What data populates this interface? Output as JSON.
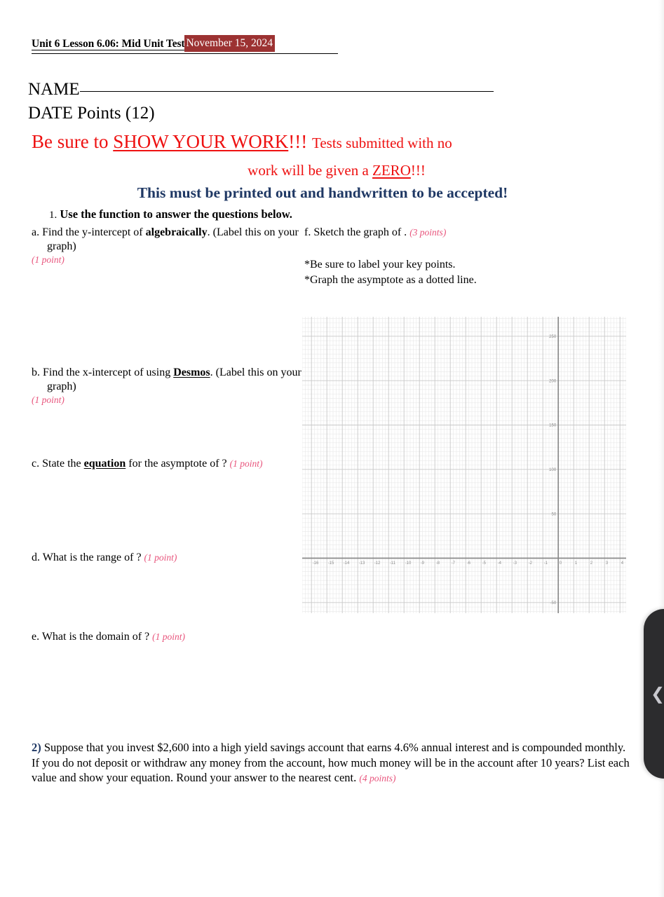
{
  "header": {
    "title": "Unit 6 Lesson 6.06: Mid Unit Test",
    "date": "November 15, 2024",
    "date_highlight_color": "#9c3232"
  },
  "fields": {
    "name_label": "NAME",
    "date_label": "DATE",
    "points_label": "Points (12)"
  },
  "warnings": {
    "line1_a": "Be sure to ",
    "line1_b": "SHOW YOUR WORK",
    "line1_c": "!!!",
    "line1_d": "Tests submitted with no",
    "line2_a": "work will be given a ",
    "line2_b": "ZERO",
    "line2_c": "!!!",
    "line3": "This must be printed out and handwritten to be accepted!",
    "red_color": "#ee1111",
    "blue_color": "#1f3864"
  },
  "question1": {
    "number": "1.",
    "stem": "Use the function to answer the questions below.",
    "parts": [
      {
        "letter": "a.",
        "text": "Find the y-intercept of ",
        "bold": "algebraically",
        "text_tail": ". (Label this on your graph)",
        "points": "(1 point)"
      },
      {
        "letter": "b.",
        "text": "Find the x-intercept of using ",
        "bold": "Desmos",
        "text_tail": ". (Label this on your graph)",
        "points": "(1 point)"
      },
      {
        "letter": "c.",
        "text": "State the ",
        "bold": "equation",
        "text_tail": " for the asymptote of ?",
        "points": "(1 point)"
      },
      {
        "letter": "d.",
        "text": "What is the range of ?",
        "points": "(1 point)"
      },
      {
        "letter": "e.",
        "text": "What is the domain of ?",
        "points": "(1 point)"
      },
      {
        "letter": "f.",
        "text": "Sketch the graph of .",
        "points": "(3  points)"
      }
    ],
    "notes": [
      "*Be sure to label your key points.",
      "*Graph the asymptote as a dotted line."
    ]
  },
  "question2": {
    "number": "2)",
    "text": " Suppose that you invest $2,600 into a high yield savings account that earns 4.6% annual interest and is compounded monthly.  If you do not deposit or withdraw any money from the account, how much money will be in the account after 10 years? List each value and show your equation.  Round your answer to the nearest cent. ",
    "points": "(4 points)"
  },
  "side_panel": {
    "icon": "chevron-left-icon"
  },
  "chart_data": {
    "type": "scatter",
    "title": "",
    "xlabel": "",
    "ylabel": "",
    "xlim": [
      -16.6,
      4.4
    ],
    "ylim": [
      -62,
      272
    ],
    "x_ticks": [
      -16,
      -15,
      -14,
      -13,
      -12,
      -11,
      -10,
      -9,
      -8,
      -7,
      -6,
      -5,
      -4,
      -3,
      -2,
      -1,
      0,
      1,
      2,
      3,
      4
    ],
    "x_tick_labels": [
      "-16",
      "-15",
      "-14",
      "-13",
      "-12",
      "-11",
      "-10",
      "-9",
      "-8",
      "-7",
      "-6",
      "-5",
      "-4",
      "-3",
      "-2",
      "-1",
      "0",
      "1",
      "2",
      "3",
      "4"
    ],
    "y_ticks": [
      -50,
      0,
      50,
      100,
      150,
      200,
      250
    ],
    "y_tick_labels": [
      "-50",
      "",
      "50",
      "100",
      "150",
      "200",
      "250"
    ],
    "x_major_step": 1,
    "y_major_step": 50,
    "minor_per_major_x": 5,
    "minor_per_major_y": 10,
    "grid": true,
    "series": [],
    "axis_color": "#999999",
    "grid_major_color": "#c9c9c9",
    "grid_minor_color": "#e8e8e8"
  }
}
